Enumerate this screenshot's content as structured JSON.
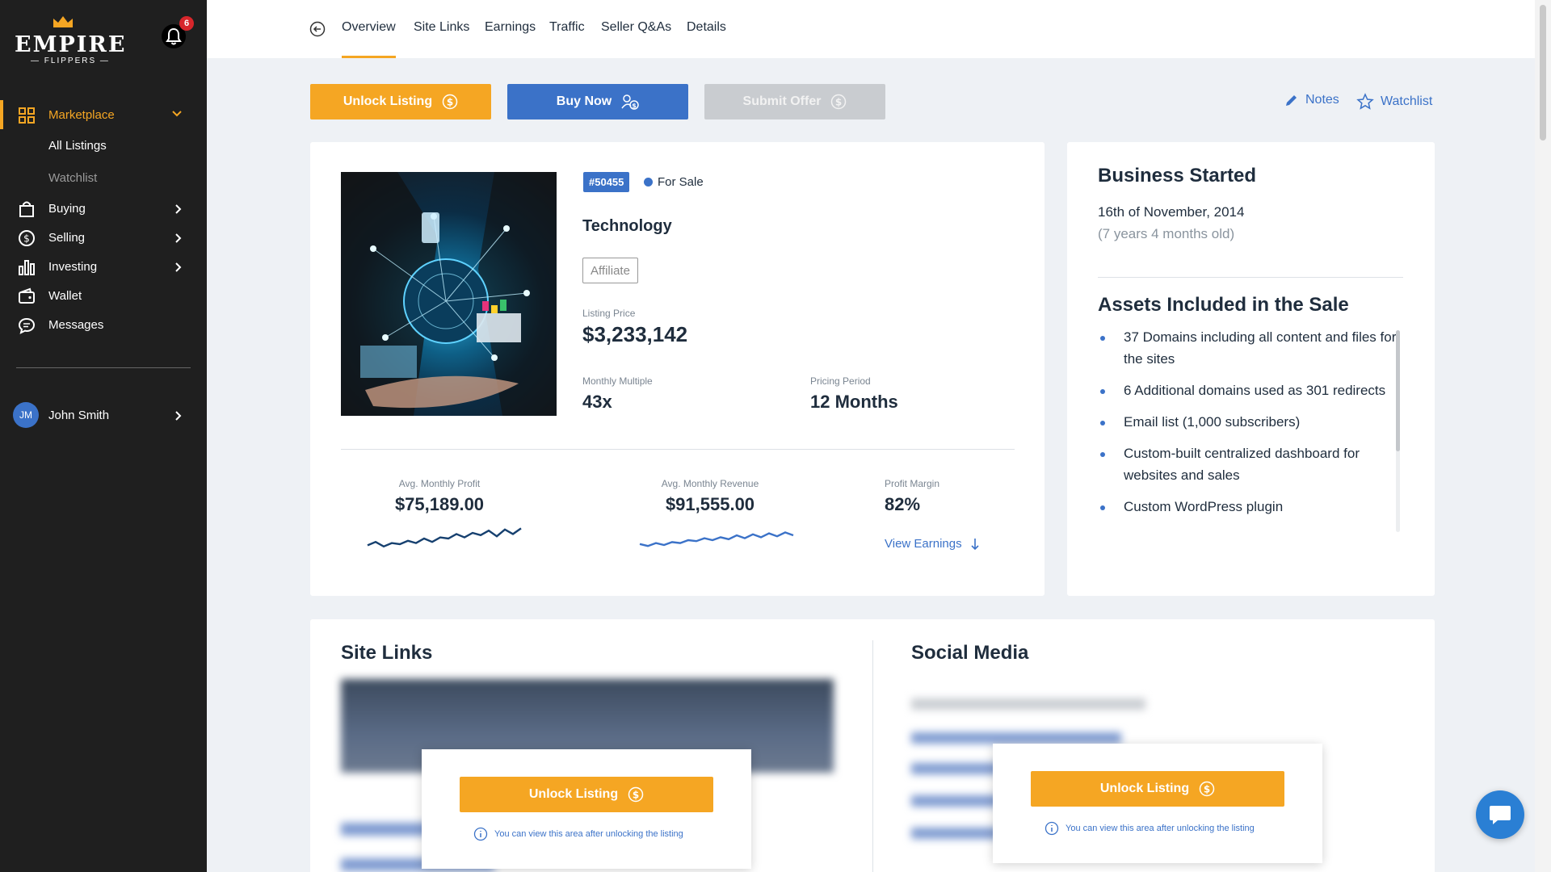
{
  "brand": {
    "name": "EMPIRE",
    "tagline": "FLIPPERS",
    "accent": "#f5a623",
    "blue": "#3b72c8"
  },
  "notifications": {
    "count": "6"
  },
  "sidebar": {
    "marketplace": "Marketplace",
    "sub": [
      "All Listings",
      "Watchlist"
    ],
    "items": [
      "Buying",
      "Selling",
      "Investing",
      "Wallet",
      "Messages"
    ],
    "user": {
      "initials": "JM",
      "name": "John Smith"
    }
  },
  "tabs": [
    "Overview",
    "Site Links",
    "Earnings",
    "Traffic",
    "Seller Q&As",
    "Details"
  ],
  "actions": {
    "unlock": "Unlock Listing",
    "buy": "Buy Now",
    "offer": "Submit Offer",
    "notes": "Notes",
    "watchlist": "Watchlist"
  },
  "listing": {
    "id": "#50455",
    "status": "For Sale",
    "niche": "Technology",
    "monetization": "Affiliate",
    "price_label": "Listing Price",
    "price": "$3,233,142",
    "multiple_label": "Monthly Multiple",
    "multiple": "43x",
    "period_label": "Pricing Period",
    "period": "12 Months",
    "profit_label": "Avg. Monthly Profit",
    "profit": "$75,189.00",
    "revenue_label": "Avg. Monthly Revenue",
    "revenue": "$91,555.00",
    "margin_label": "Profit Margin",
    "margin": "82%",
    "view_earnings": "View Earnings",
    "profit_trend": [
      0.2,
      0.35,
      0.15,
      0.3,
      0.25,
      0.4,
      0.3,
      0.5,
      0.35,
      0.55,
      0.5,
      0.7,
      0.55,
      0.75,
      0.65,
      0.85,
      0.6,
      0.9,
      0.7,
      0.95
    ],
    "revenue_trend": [
      0.3,
      0.2,
      0.35,
      0.25,
      0.4,
      0.35,
      0.5,
      0.45,
      0.6,
      0.5,
      0.65,
      0.55,
      0.75,
      0.6,
      0.8,
      0.65,
      0.85,
      0.7,
      0.9,
      0.75
    ]
  },
  "business": {
    "started_title": "Business Started",
    "started_date": "16th of November, 2014",
    "age": "(7 years 4 months old)",
    "assets_title": "Assets Included in the Sale",
    "assets": [
      "37 Domains including all content and files for the sites",
      "6 Additional domains used as 301 redirects",
      "Email list (1,000 subscribers)",
      "Custom-built centralized dashboard for websites and sales",
      "Custom WordPress plugin"
    ]
  },
  "site_links": {
    "title": "Site Links",
    "unlock": "Unlock Listing",
    "note": "You can view this area after unlocking the listing"
  },
  "social": {
    "title": "Social Media",
    "unlock": "Unlock Listing",
    "note": "You can view this area after unlocking the listing"
  }
}
